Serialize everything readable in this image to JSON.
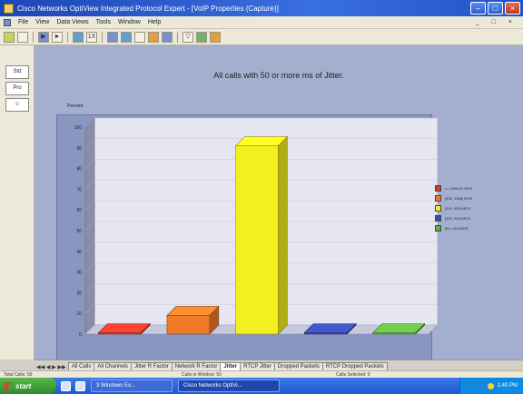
{
  "window": {
    "title": "Cisco Networks OptiView Integrated Protocol Expert - [VoIP Properties (Capture)]"
  },
  "menu": [
    "File",
    "View",
    "Data Views",
    "Tools",
    "Window",
    "Help"
  ],
  "toolbar": {
    "zoom_label": "1X"
  },
  "left_panel": [
    "Std",
    "Pro"
  ],
  "chart_data": {
    "type": "bar",
    "title": "All calls with 50 or more ms of Jitter.",
    "ylabel": "Percent",
    "ylim": [
      0,
      100
    ],
    "yticks": [
      0,
      10,
      20,
      30,
      40,
      50,
      60,
      70,
      80,
      90,
      100
    ],
    "grid": true,
    "legend_position": "right",
    "series": [
      {
        "name": "<= 1956.42 MOS",
        "color": "#d83a2a",
        "value": 0
      },
      {
        "name": "[400, 1956] MOS",
        "color": "#f07a2a",
        "value": 9
      },
      {
        "name": "[200, 400] MOS",
        "color": "#f4f020",
        "value": 91
      },
      {
        "name": "[100, 200] MOS",
        "color": "#3a4ab0",
        "value": 0
      },
      {
        "name": "[50, 100] MOS",
        "color": "#60b040",
        "value": 0
      }
    ]
  },
  "tabs": [
    {
      "label": "All Calls",
      "active": false
    },
    {
      "label": "All Channels",
      "active": false
    },
    {
      "label": "Jitter R Factor",
      "active": false
    },
    {
      "label": "Network R Factor",
      "active": false
    },
    {
      "label": "Jitter",
      "active": true
    },
    {
      "label": "RTCP Jitter",
      "active": false
    },
    {
      "label": "Dropped Packets",
      "active": false
    },
    {
      "label": "RTCP Dropped Packets",
      "active": false
    }
  ],
  "status": {
    "left": "Total Calls: 50",
    "mid": "Calls in Window: 50",
    "right": "Calls Selected: 0"
  },
  "taskbar": {
    "start_label": "start",
    "items": [
      {
        "label": "3 Windows Ex...",
        "active": false
      },
      {
        "label": "Cisco Networks OptiVi...",
        "active": true
      }
    ],
    "clock": "1:40 PM"
  }
}
